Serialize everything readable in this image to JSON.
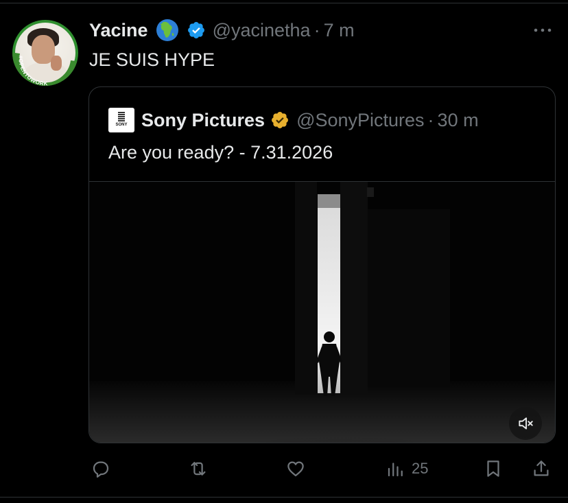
{
  "tweet": {
    "display_name": "Yacine",
    "handle": "@yacinetha",
    "separator": "·",
    "time": "7 m",
    "text": "JE SUIS HYPE",
    "avatar_badge": "#OPENTOWORK",
    "globe_icon": "earth-africa-icon",
    "verified_color": "#1d9bf0"
  },
  "quote": {
    "display_name": "Sony Pictures",
    "handle": "@SonyPictures",
    "separator": "·",
    "time": "30 m",
    "text": "Are you ready? - 7.31.2026",
    "logo_text": "SONY",
    "verified_color": "#e8b02e",
    "media": {
      "type": "video",
      "muted": true
    }
  },
  "actions": {
    "reply_icon": "reply-icon",
    "retweet_icon": "retweet-icon",
    "like_icon": "heart-icon",
    "views_icon": "views-chart-icon",
    "views_count": "25",
    "bookmark_icon": "bookmark-icon",
    "share_icon": "share-icon"
  },
  "colors": {
    "background": "#000000",
    "text": "#e7e9ea",
    "secondary_text": "#71767b",
    "border": "#2f3336"
  }
}
